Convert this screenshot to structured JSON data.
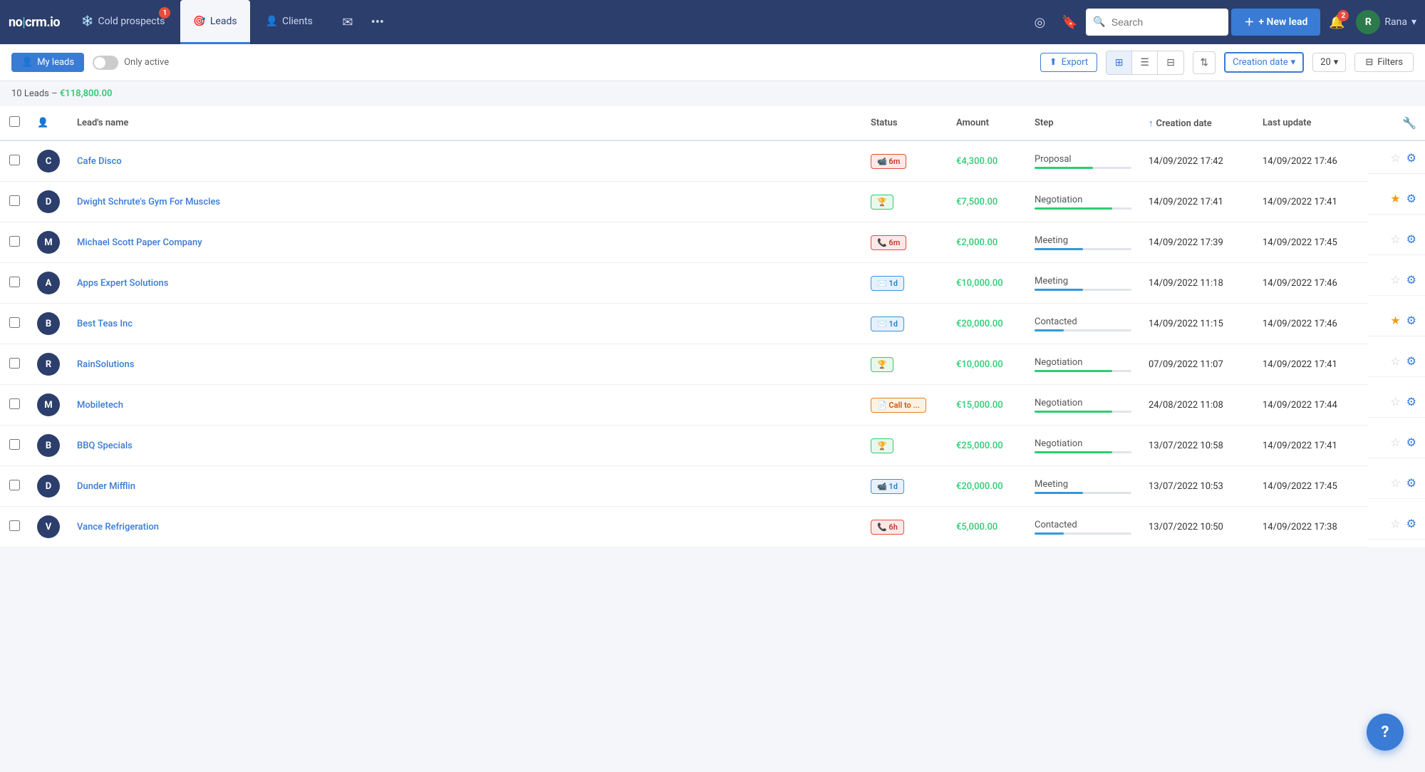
{
  "app": {
    "logo": "no|crm.io"
  },
  "nav": {
    "tabs": [
      {
        "id": "cold-prospects",
        "label": "Cold prospects",
        "icon": "❄️",
        "badge": "1",
        "active": false
      },
      {
        "id": "leads",
        "label": "Leads",
        "icon": "🎯",
        "badge": null,
        "active": true
      },
      {
        "id": "clients",
        "label": "Clients",
        "icon": "👤",
        "badge": null,
        "active": false
      }
    ],
    "search_placeholder": "Search",
    "new_lead_label": "+ New lead",
    "notification_count": "2",
    "user_name": "Rana"
  },
  "toolbar": {
    "my_leads_label": "My leads",
    "only_active_label": "Only active",
    "export_label": "Export",
    "date_filter": "Creation date",
    "per_page": "20",
    "filters_label": "Filters"
  },
  "summary": {
    "count": "10",
    "label": "Leads",
    "amount": "€118,800.00"
  },
  "table": {
    "columns": [
      "Lead's name",
      "Status",
      "Amount",
      "Step",
      "Creation date",
      "Last update"
    ],
    "rows": [
      {
        "name": "Cafe Disco",
        "avatar_bg": "#2c3e6b",
        "avatar_text": "C",
        "status_type": "red",
        "status_icon": "📹",
        "status_label": "6m",
        "amount": "€4,300.00",
        "step": "Proposal",
        "step_pct": 60,
        "step_color": "fill-green",
        "creation_date": "14/09/2022 17:42",
        "last_update": "14/09/2022 17:46",
        "starred": false
      },
      {
        "name": "Dwight Schrute's Gym For Muscles",
        "avatar_bg": "#2c3e6b",
        "avatar_text": "D",
        "status_type": "green",
        "status_icon": "🏆",
        "status_label": "",
        "amount": "€7,500.00",
        "step": "Negotiation",
        "step_pct": 80,
        "step_color": "fill-green",
        "creation_date": "14/09/2022 17:41",
        "last_update": "14/09/2022 17:41",
        "starred": true
      },
      {
        "name": "Michael Scott Paper Company",
        "avatar_bg": "#2c3e6b",
        "avatar_text": "M",
        "status_type": "red",
        "status_icon": "📞",
        "status_label": "6m",
        "amount": "€2,000.00",
        "step": "Meeting",
        "step_pct": 50,
        "step_color": "fill-blue",
        "creation_date": "14/09/2022 17:39",
        "last_update": "14/09/2022 17:45",
        "starred": false
      },
      {
        "name": "Apps Expert Solutions",
        "avatar_bg": "#2c3e6b",
        "avatar_text": "A",
        "status_type": "blue",
        "status_icon": "✉️",
        "status_label": "1d",
        "amount": "€10,000.00",
        "step": "Meeting",
        "step_pct": 50,
        "step_color": "fill-blue",
        "creation_date": "14/09/2022 11:18",
        "last_update": "14/09/2022 17:46",
        "starred": false
      },
      {
        "name": "Best Teas Inc",
        "avatar_bg": "#2c3e6b",
        "avatar_text": "B",
        "status_type": "blue",
        "status_icon": "✉️",
        "status_label": "1d",
        "amount": "€20,000.00",
        "step": "Contacted",
        "step_pct": 30,
        "step_color": "fill-blue",
        "creation_date": "14/09/2022 11:15",
        "last_update": "14/09/2022 17:46",
        "starred": true
      },
      {
        "name": "RainSolutions",
        "avatar_bg": "#2c3e6b",
        "avatar_text": "R",
        "status_type": "green",
        "status_icon": "🏆",
        "status_label": "",
        "amount": "€10,000.00",
        "step": "Negotiation",
        "step_pct": 80,
        "step_color": "fill-green",
        "creation_date": "07/09/2022 11:07",
        "last_update": "14/09/2022 17:41",
        "starred": false
      },
      {
        "name": "Mobiletech",
        "avatar_bg": "#2c3e6b",
        "avatar_text": "M",
        "status_type": "orange",
        "status_icon": "📄",
        "status_label": "Call to ...",
        "amount": "€15,000.00",
        "step": "Negotiation",
        "step_pct": 80,
        "step_color": "fill-green",
        "creation_date": "24/08/2022 11:08",
        "last_update": "14/09/2022 17:44",
        "starred": false
      },
      {
        "name": "BBQ Specials",
        "avatar_bg": "#2c3e6b",
        "avatar_text": "B",
        "status_type": "green",
        "status_icon": "🏆",
        "status_label": "",
        "amount": "€25,000.00",
        "step": "Negotiation",
        "step_pct": 80,
        "step_color": "fill-green",
        "creation_date": "13/07/2022 10:58",
        "last_update": "14/09/2022 17:41",
        "starred": false
      },
      {
        "name": "Dunder Mifflin",
        "avatar_bg": "#2c3e6b",
        "avatar_text": "D",
        "status_type": "blue",
        "status_icon": "📹",
        "status_label": "1d",
        "amount": "€20,000.00",
        "step": "Meeting",
        "step_pct": 50,
        "step_color": "fill-blue",
        "creation_date": "13/07/2022 10:53",
        "last_update": "14/09/2022 17:45",
        "starred": false
      },
      {
        "name": "Vance Refrigeration",
        "avatar_bg": "#2c3e6b",
        "avatar_text": "V",
        "status_type": "red",
        "status_icon": "📞",
        "status_label": "6h",
        "amount": "€5,000.00",
        "step": "Contacted",
        "step_pct": 30,
        "step_color": "fill-blue",
        "creation_date": "13/07/2022 10:50",
        "last_update": "14/09/2022 17:38",
        "starred": false
      }
    ]
  },
  "help": {
    "label": "?"
  }
}
